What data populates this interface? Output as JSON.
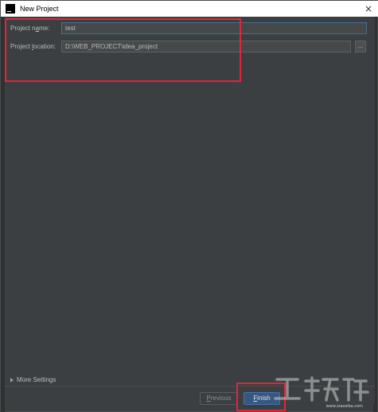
{
  "window": {
    "title": "New Project",
    "close_glyph": "×"
  },
  "form": {
    "project_name_label_pre": "Project n",
    "project_name_label_mn": "a",
    "project_name_label_post": "me:",
    "project_name_value": "test",
    "project_location_label_pre": "Project ",
    "project_location_label_mn": "l",
    "project_location_label_post": "ocation:",
    "project_location_value": "D:\\WEB_PROJECT\\idea_project",
    "browse_label": "..."
  },
  "footer": {
    "more_settings_label": "More Settings",
    "previous_mn": "P",
    "previous_rest": "revious",
    "finish_mn": "F",
    "finish_rest": "inish"
  },
  "colors": {
    "highlight": "#e0263a",
    "primary_button": "#365880",
    "background": "#3c3f41"
  },
  "watermark": {
    "text": "www.xiazaiba.com"
  }
}
